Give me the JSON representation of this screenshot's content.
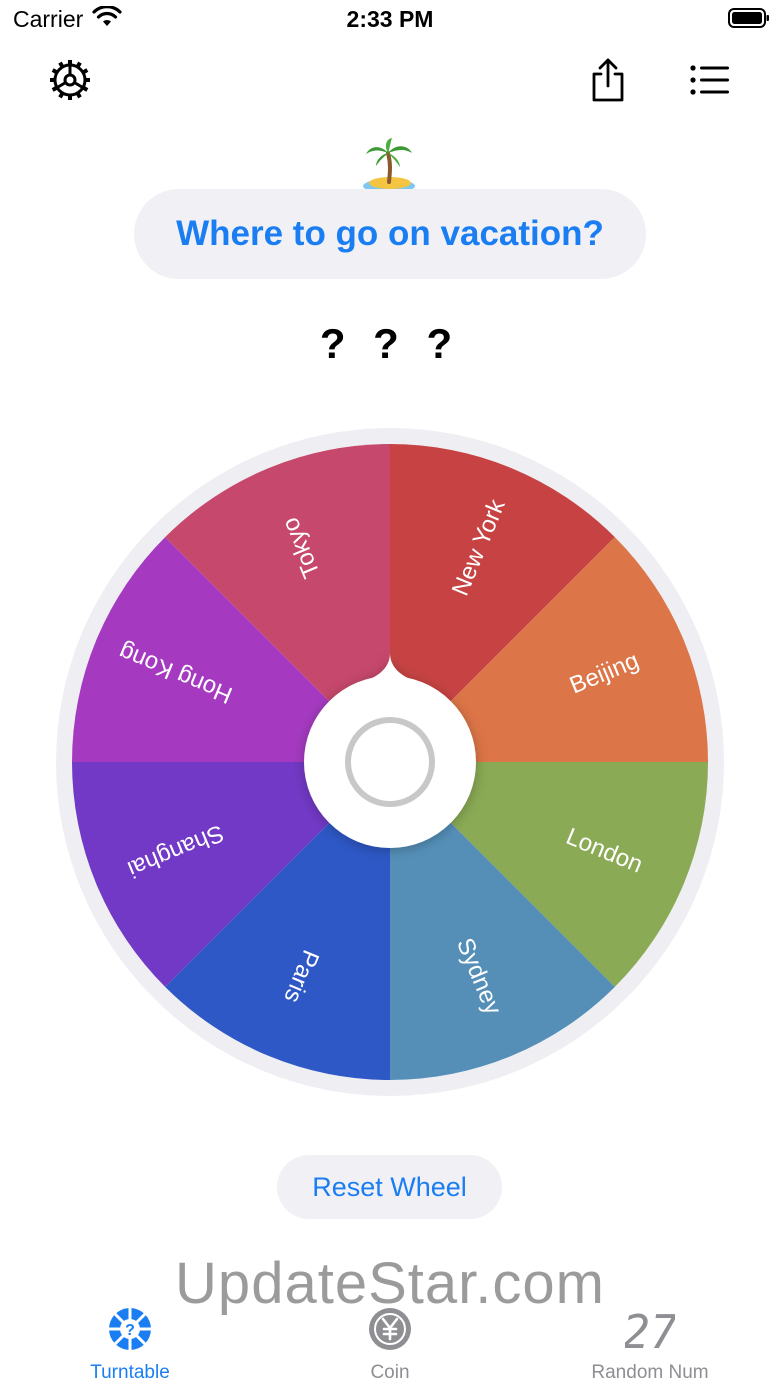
{
  "status_bar": {
    "carrier": "Carrier",
    "time": "2:33 PM"
  },
  "toolbar": {
    "settings_icon": "gear-icon",
    "share_icon": "share-icon",
    "list_icon": "list-icon"
  },
  "header": {
    "emoji": "palm-tree-island-emoji",
    "title": "Where to go on vacation?"
  },
  "result": {
    "text": "? ? ?"
  },
  "wheel": {
    "segments": [
      {
        "label": "New York",
        "color": "#c74343"
      },
      {
        "label": "Beijing",
        "color": "#dc7548"
      },
      {
        "label": "London",
        "color": "#8aaa55"
      },
      {
        "label": "Sydney",
        "color": "#558fb8"
      },
      {
        "label": "Paris",
        "color": "#2e58c6"
      },
      {
        "label": "Shanghai",
        "color": "#7239c6"
      },
      {
        "label": "Hong Kong",
        "color": "#a53ac1"
      },
      {
        "label": "Tokyo",
        "color": "#c6486c"
      }
    ]
  },
  "actions": {
    "reset_label": "Reset Wheel"
  },
  "watermark": "UpdateStar.com",
  "tabs": [
    {
      "label": "Turntable",
      "active": true,
      "icon": "turntable-icon"
    },
    {
      "label": "Coin",
      "active": false,
      "icon": "coin-icon"
    },
    {
      "label": "Random Num",
      "active": false,
      "icon": "random-number-icon",
      "icon_text": "27"
    }
  ],
  "colors": {
    "accent": "#1a7ef2",
    "inactive": "#8e8e93",
    "pill_bg": "#f1f1f5"
  }
}
